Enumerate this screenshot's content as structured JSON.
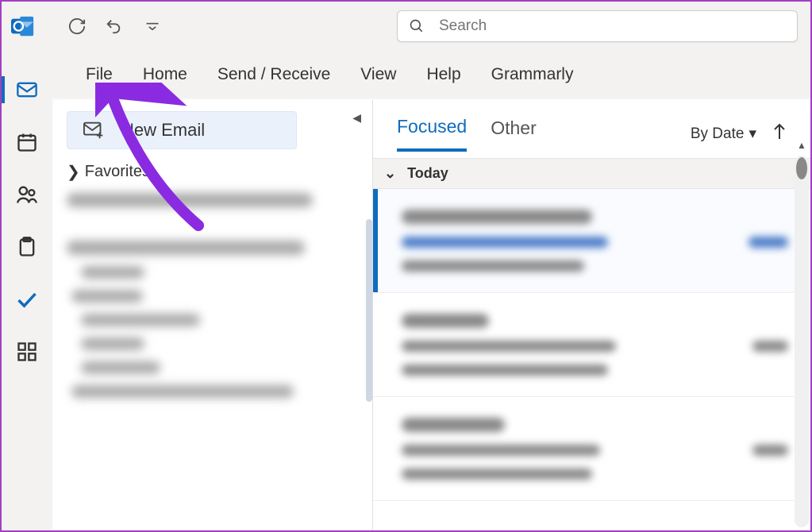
{
  "title_bar": {
    "search_placeholder": "Search"
  },
  "ribbon": {
    "tabs": [
      "File",
      "Home",
      "Send / Receive",
      "View",
      "Help",
      "Grammarly"
    ]
  },
  "rail": {
    "items": [
      "mail",
      "calendar",
      "people",
      "tasks",
      "todo",
      "apps"
    ]
  },
  "folder_pane": {
    "new_email_label": "New Email",
    "favorites_label": "Favorites"
  },
  "message_pane": {
    "tab_focused": "Focused",
    "tab_other": "Other",
    "sort_label": "By Date",
    "group_today": "Today"
  }
}
